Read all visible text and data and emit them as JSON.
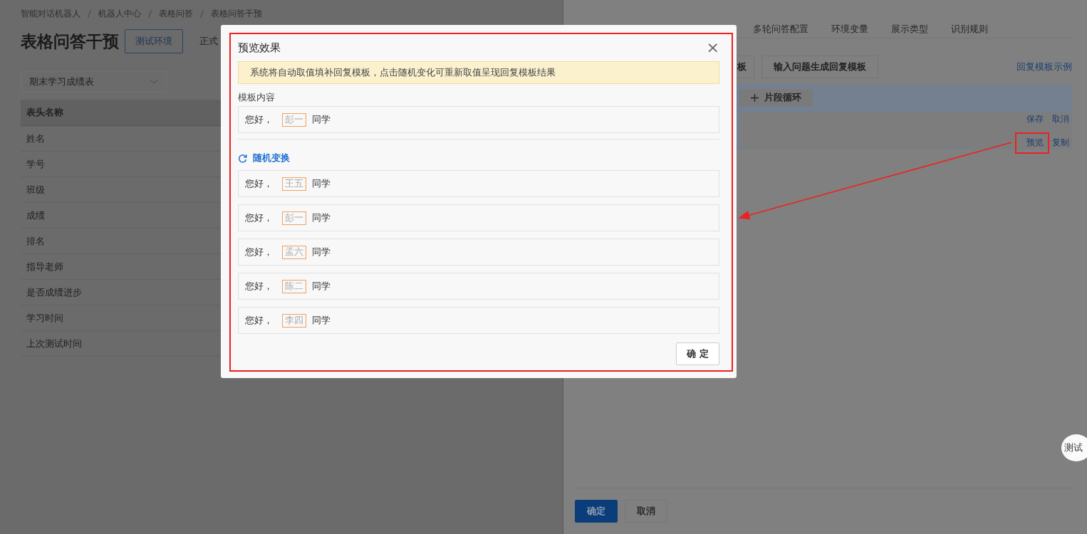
{
  "breadcrumb": [
    "智能对话机器人",
    "机器人中心",
    "表格问答",
    "表格问答干预"
  ],
  "page_title": "表格问答干预",
  "env_tabs": [
    {
      "label": "测试环境",
      "selected": true
    },
    {
      "label": "正式",
      "selected": false
    }
  ],
  "table_select": {
    "value": "期末学习成绩表"
  },
  "table": {
    "columns": [
      "表头名称"
    ],
    "rows": [
      "姓名",
      "学号",
      "班级",
      "成绩",
      "排名",
      "指导老师",
      "是否成绩进步",
      "学习时间",
      "上次测试时间"
    ]
  },
  "drawer": {
    "tabs": [
      "多轮问答配置",
      "环境变量",
      "展示类型",
      "识别规则"
    ],
    "toolbar_buttons": [
      "板",
      "输入问题生成回复模板"
    ],
    "example_link": "回复模板示例",
    "loop_button": "片段循环",
    "row_actions": [
      [
        "保存",
        "取消"
      ],
      [
        "预览",
        "复制"
      ]
    ],
    "footer_buttons": [
      {
        "label": "确定",
        "kind": "primary"
      },
      {
        "label": "取消",
        "kind": "default"
      }
    ]
  },
  "float_button": "测试",
  "modal": {
    "title": "预览效果",
    "close": "×",
    "notice": "系统将自动取值填补回复模板，点击随机变化可重新取值呈现回复模板结果",
    "template_label": "模板内容",
    "template": {
      "before": "您好，",
      "slot": "彭一",
      "after": "同学"
    },
    "shuffle": "随机变换",
    "results": [
      {
        "before": "您好，",
        "slot": "王五",
        "after": "同学"
      },
      {
        "before": "您好，",
        "slot": "彭一",
        "after": "同学"
      },
      {
        "before": "您好，",
        "slot": "孟六",
        "after": "同学"
      },
      {
        "before": "您好，",
        "slot": "陈二",
        "after": "同学"
      },
      {
        "before": "您好，",
        "slot": "李四",
        "after": "同学"
      }
    ],
    "ok": "确 定"
  }
}
